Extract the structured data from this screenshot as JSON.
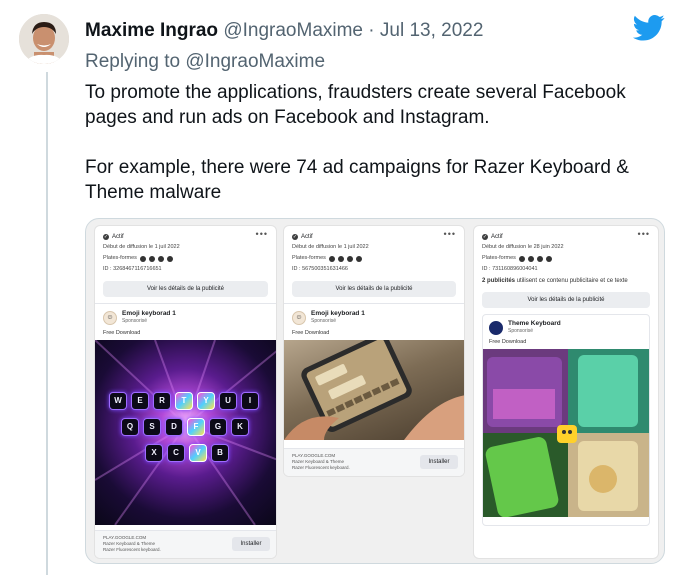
{
  "tweet": {
    "author_name": "Maxime Ingrao",
    "author_handle": "@IngraoMaxime",
    "separator": "·",
    "date": "Jul 13, 2022",
    "reply_prefix": "Replying to",
    "reply_to": "@IngraoMaxime",
    "paragraph1": "To promote the applications, fraudsters create several Facebook pages and run ads on Facebook and Instagram.",
    "paragraph2": "For example, there were 74 ad campaigns for Razer Keyboard & Theme malware"
  },
  "colors": {
    "twitter_blue": "#1d9bf0",
    "muted_text": "#536471",
    "thread_line": "#cfd9de"
  },
  "ads": [
    {
      "status": "Actif",
      "more": "•••",
      "start_date": "Début de diffusion le 1 juil 2022",
      "platforms_label": "Plates-formes",
      "id": "ID : 3268467116716651",
      "details_button": "Voir les détails de la publicité",
      "page_name": "Emoji keyborad 1",
      "sponsored": "Sponsorisé",
      "description": "Free Download",
      "footer_domain": "PLAY.GOOGLE.COM",
      "footer_title": "Razer Keyboard & Theme",
      "footer_sub": "Razer Fluorescent keyboard.",
      "install_button": "Installer",
      "keys_row1": [
        "W",
        "E",
        "R",
        "T",
        "Y",
        "U",
        "I"
      ],
      "keys_row2": [
        "Q",
        "S",
        "D",
        "F",
        "G",
        "K"
      ],
      "keys_row3": [
        "X",
        "C",
        "V",
        "B"
      ]
    },
    {
      "status": "Actif",
      "more": "•••",
      "start_date": "Début de diffusion le 1 juil 2022",
      "platforms_label": "Plates-formes",
      "id": "ID : 567500351631466",
      "details_button": "Voir les détails de la publicité",
      "page_name": "Emoji keyborad 1",
      "sponsored": "Sponsorisé",
      "description": "Free Download",
      "footer_domain": "PLAY.GOOGLE.COM",
      "footer_title": "Razer Keyboard & Theme",
      "footer_sub": "Razer Fluorescent keyboard.",
      "install_button": "Installer"
    },
    {
      "status": "Actif",
      "more": "•••",
      "start_date": "Début de diffusion le 28 juin 2022",
      "platforms_label": "Plates-formes",
      "id": "ID : 731160896004041",
      "uses_count": "2 publicités",
      "uses_text": "utilisent ce contenu publicitaire et ce texte",
      "details_button": "Voir les détails de la publicité",
      "page_name": "Theme Keyboard",
      "sponsored": "Sponsorisé",
      "description": "Free Download"
    }
  ]
}
